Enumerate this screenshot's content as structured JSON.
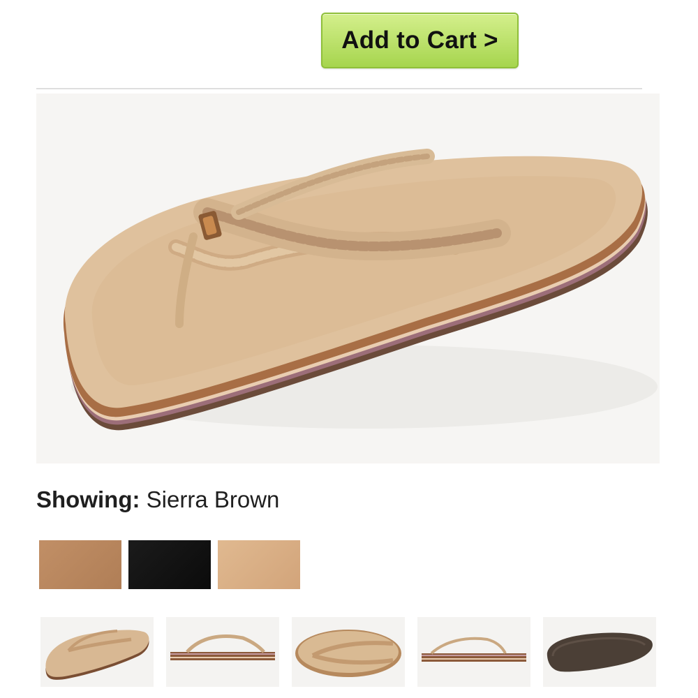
{
  "cart": {
    "button_label": "Add to Cart >",
    "button_color": "#a6d54e"
  },
  "product": {
    "showing_label": "Showing:",
    "showing_value": "Sierra Brown",
    "main_image_icon": "sandal-image"
  },
  "swatches": [
    {
      "icon": "color-swatch",
      "color": "#b98760"
    },
    {
      "icon": "color-swatch",
      "color": "#151515"
    },
    {
      "icon": "color-swatch",
      "color": "#d9ae84"
    }
  ],
  "thumbnails": [
    {
      "icon": "sandal-angle-view"
    },
    {
      "icon": "sandal-side-view"
    },
    {
      "icon": "sandal-top-view"
    },
    {
      "icon": "sandal-side-view"
    },
    {
      "icon": "sandal-sole-view"
    }
  ]
}
